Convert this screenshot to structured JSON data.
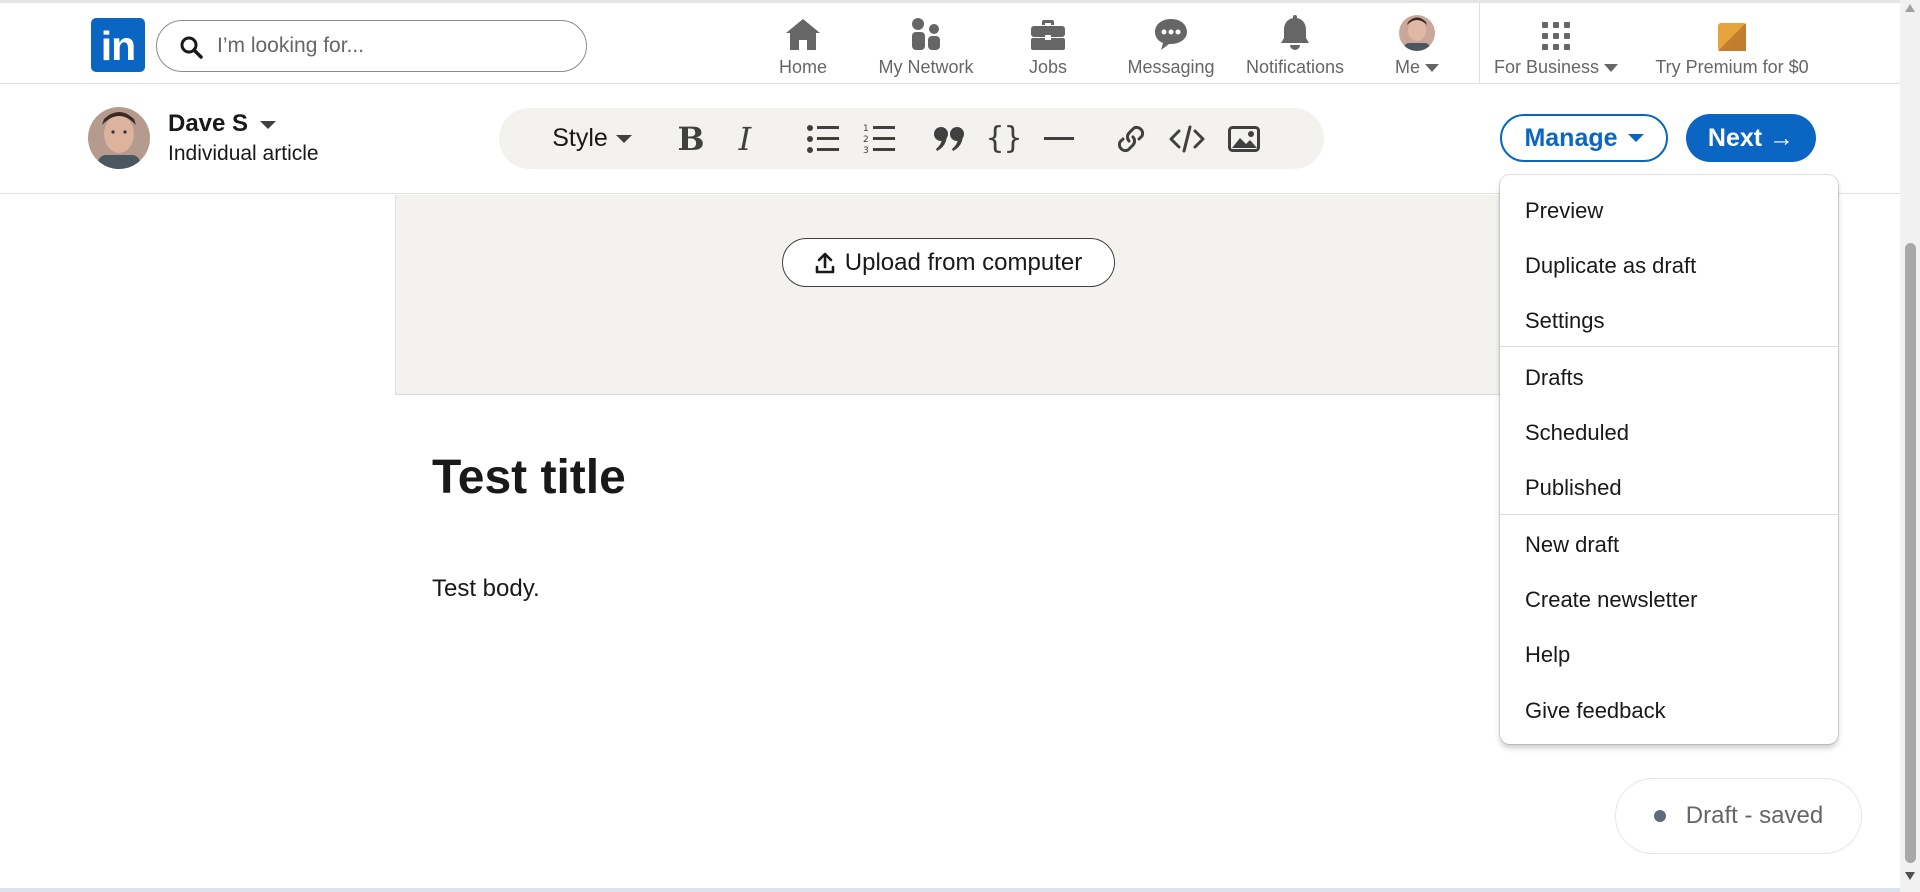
{
  "nav": {
    "logo_text": "in",
    "search_placeholder": "I’m looking for...",
    "items": [
      {
        "label": "Home"
      },
      {
        "label": "My Network"
      },
      {
        "label": "Jobs"
      },
      {
        "label": "Messaging"
      },
      {
        "label": "Notifications"
      },
      {
        "label": "Me"
      },
      {
        "label": "For Business"
      },
      {
        "label": "Try Premium for $0"
      }
    ]
  },
  "author": {
    "name": "Dave S",
    "type": "Individual article"
  },
  "toolbar": {
    "style_label": "Style"
  },
  "actions": {
    "manage_label": "Manage",
    "next_label": "Next →"
  },
  "cover": {
    "upload_label": "Upload from computer"
  },
  "article": {
    "title": "Test title",
    "body": "Test body."
  },
  "manage_menu": {
    "items": [
      {
        "label": "Preview"
      },
      {
        "label": "Duplicate as draft"
      },
      {
        "label": "Settings"
      },
      {
        "label": "Drafts"
      },
      {
        "label": "Scheduled"
      },
      {
        "label": "Published"
      },
      {
        "label": "New draft"
      },
      {
        "label": "Create newsletter"
      },
      {
        "label": "Help"
      },
      {
        "label": "Give feedback"
      }
    ]
  },
  "status": {
    "draft_label": "Draft - saved"
  },
  "colors": {
    "brand": "#0a66c2",
    "premium": "#e7a33e"
  }
}
